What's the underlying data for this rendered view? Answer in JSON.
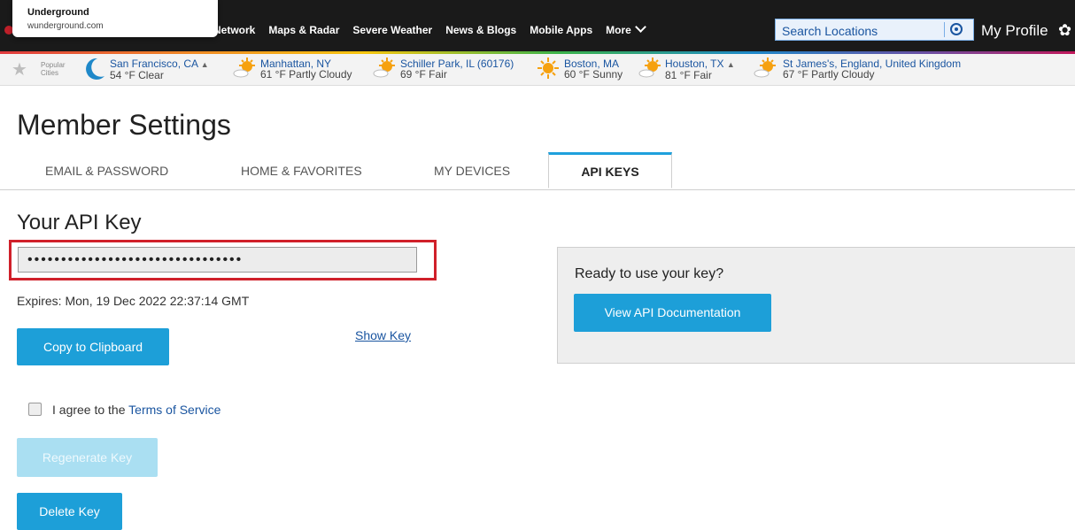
{
  "tooltip": {
    "title": "Underground",
    "url": "wunderground.com"
  },
  "nav": {
    "links": [
      "Network",
      "Maps & Radar",
      "Severe Weather",
      "News & Blogs",
      "Mobile Apps",
      "More"
    ],
    "search_placeholder": "Search Locations",
    "profile_label": "My Profile"
  },
  "popular": {
    "line1": "Popular",
    "line2": "Cities"
  },
  "cities": [
    {
      "name": "San Francisco, CA",
      "cond": "54 °F Clear",
      "icon": "moon-icon",
      "alert": true
    },
    {
      "name": "Manhattan, NY",
      "cond": "61 °F Partly Cloudy",
      "icon": "partly-cloudy-icon",
      "alert": false
    },
    {
      "name": "Schiller Park, IL (60176)",
      "cond": "69 °F Fair",
      "icon": "partly-cloudy-icon",
      "alert": false
    },
    {
      "name": "Boston, MA",
      "cond": "60 °F Sunny",
      "icon": "sun-icon",
      "alert": false
    },
    {
      "name": "Houston, TX",
      "cond": "81 °F Fair",
      "icon": "partly-cloudy-icon",
      "alert": true
    },
    {
      "name": "St James's, England, United Kingdom",
      "cond": "67 °F Partly Cloudy",
      "icon": "partly-cloudy-icon",
      "alert": false
    }
  ],
  "page": {
    "title": "Member Settings"
  },
  "tabs": [
    {
      "label": "EMAIL & PASSWORD",
      "active": false
    },
    {
      "label": "HOME & FAVORITES",
      "active": false
    },
    {
      "label": "MY DEVICES",
      "active": false
    },
    {
      "label": "API KEYS",
      "active": true
    }
  ],
  "api": {
    "heading": "Your API Key",
    "key_value": "••••••••••••••••••••••••••••••••",
    "expires": "Expires: Mon, 19 Dec 2022 22:37:14 GMT",
    "copy_label": "Copy to Clipboard",
    "show_key_label": "Show Key",
    "agree_text": "I agree to the",
    "terms_label": "Terms of Service",
    "regenerate_label": "Regenerate Key",
    "delete_label": "Delete Key"
  },
  "panel": {
    "prompt": "Ready to use your key?",
    "docs_label": "View API Documentation"
  },
  "colors": {
    "accent": "#1d9fd8",
    "link": "#1a55a0",
    "highlight": "#d0202a",
    "nav_bg": "#1a1a1a"
  }
}
